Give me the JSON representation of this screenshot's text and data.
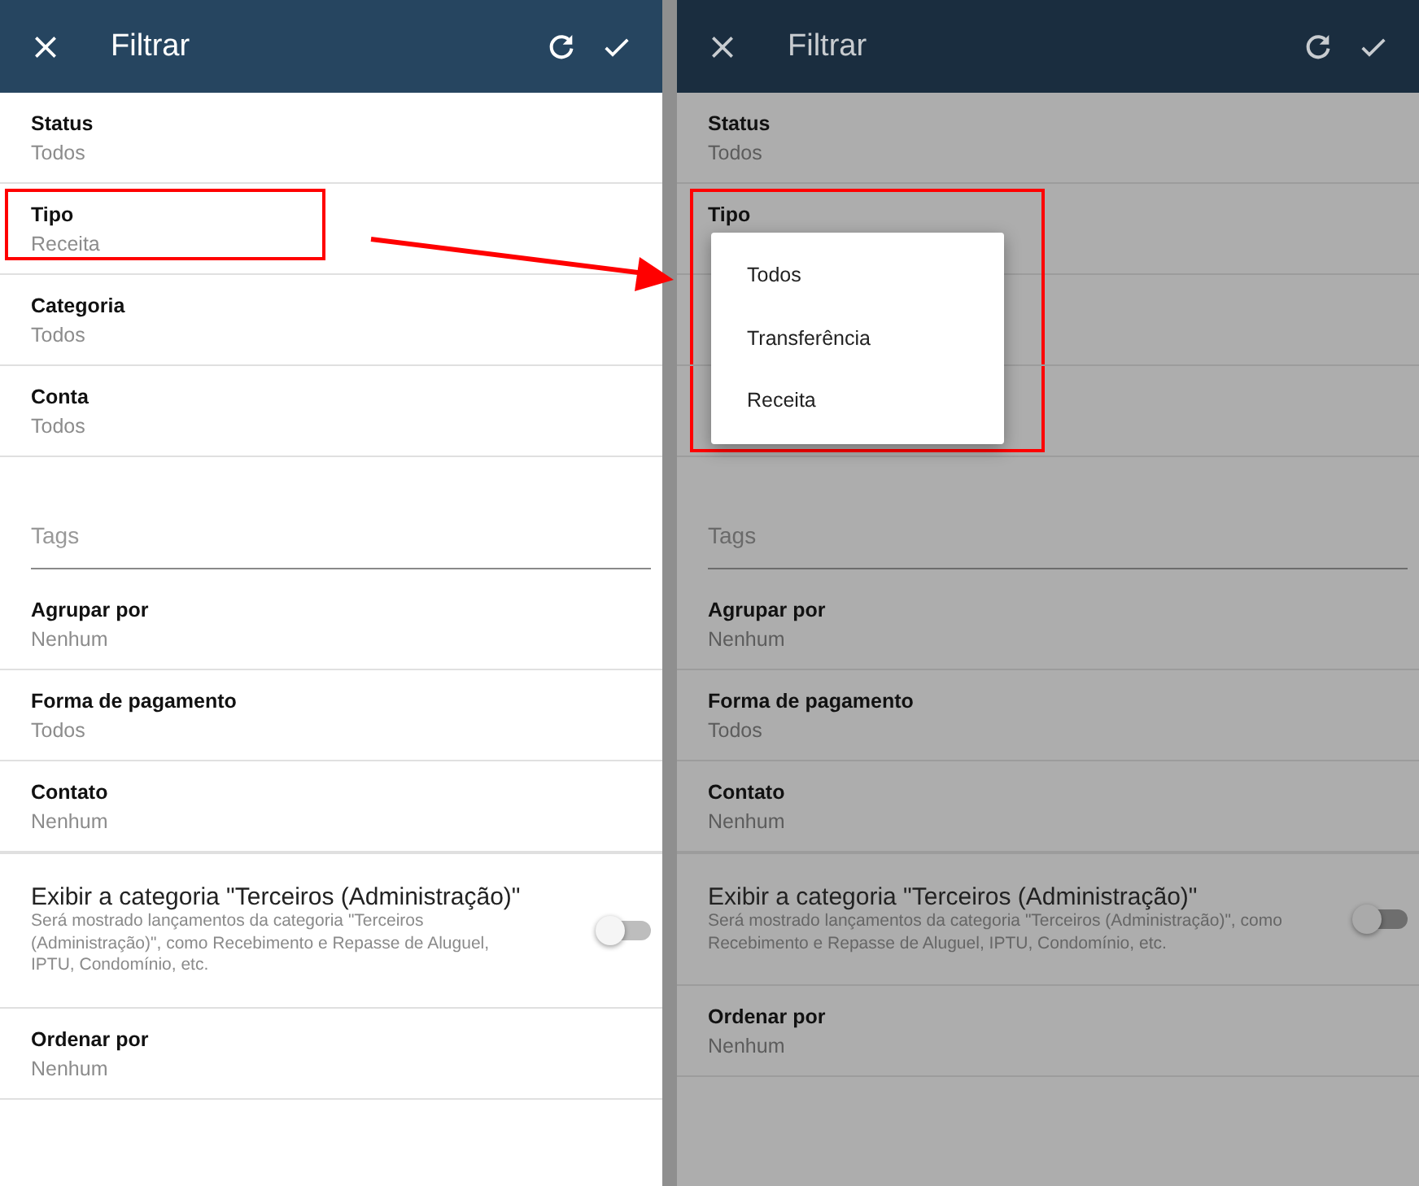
{
  "panels": [
    {
      "title": "Filtrar",
      "dimmed": false,
      "fields": [
        {
          "kind": "select",
          "label": "Status",
          "value": "Todos"
        },
        {
          "kind": "select",
          "label": "Tipo",
          "value": "Receita",
          "highlighted": true
        },
        {
          "kind": "select",
          "label": "Categoria",
          "value": "Todos"
        },
        {
          "kind": "select",
          "label": "Conta",
          "value": "Todos"
        },
        {
          "kind": "input",
          "placeholder": "Tags"
        },
        {
          "kind": "select",
          "label": "Agrupar por",
          "value": "Nenhum"
        },
        {
          "kind": "select",
          "label": "Forma de pagamento",
          "value": "Todos"
        },
        {
          "kind": "select",
          "label": "Contato",
          "value": "Nenhum"
        },
        {
          "kind": "toggle",
          "label": "Exibir a categoria \"Terceiros (Administração)\"",
          "description": "Será mostrado lançamentos da categoria \"Terceiros (Administração)\", como Recebimento e Repasse de Aluguel, IPTU, Condomínio, etc.",
          "on": false
        },
        {
          "kind": "select",
          "label": "Ordenar por",
          "value": "Nenhum"
        }
      ]
    },
    {
      "title": "Filtrar",
      "dimmed": true,
      "fields": [
        {
          "kind": "select",
          "label": "Status",
          "value": "Todos"
        },
        {
          "kind": "select",
          "label": "Tipo",
          "highlighted": true,
          "dropdown": [
            {
              "label": "Todos",
              "selected": false
            },
            {
              "label": "Transferência",
              "selected": false
            },
            {
              "label": "Receita",
              "selected": false
            }
          ]
        },
        {
          "kind": "select"
        },
        {
          "kind": "select"
        },
        {
          "kind": "input",
          "placeholder": "Tags"
        },
        {
          "kind": "select",
          "label": "Agrupar por",
          "value": "Nenhum"
        },
        {
          "kind": "select",
          "label": "Forma de pagamento",
          "value": "Todos"
        },
        {
          "kind": "select",
          "label": "Contato",
          "value": "Nenhum"
        },
        {
          "kind": "toggle",
          "label": "Exibir a categoria \"Terceiros (Administração)\"",
          "description": "Será mostrado lançamentos da categoria \"Terceiros (Administração)\", como Recebimento e Repasse de Aluguel, IPTU, Condomínio, etc.",
          "on": false
        },
        {
          "kind": "select",
          "label": "Ordenar por",
          "value": "Nenhum"
        }
      ]
    }
  ],
  "arrow": true
}
